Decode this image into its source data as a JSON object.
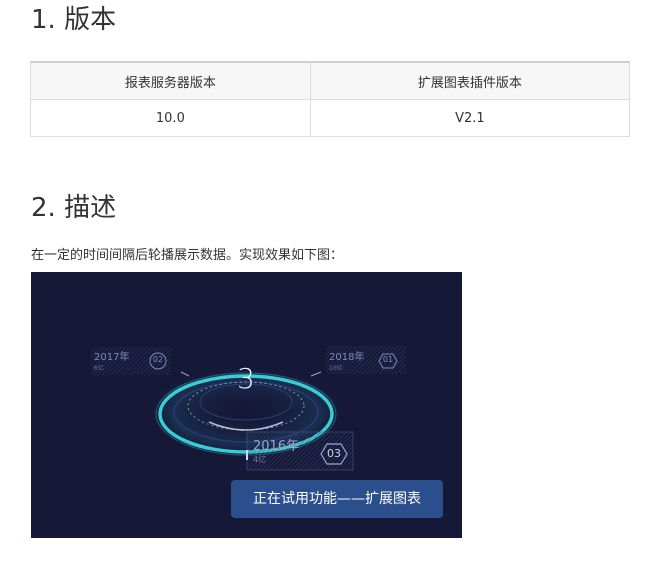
{
  "section1": {
    "title": "1. 版本"
  },
  "version_table": {
    "headers": [
      "报表服务器版本",
      "扩展图表插件版本"
    ],
    "rows": [
      [
        "10.0",
        "V2.1"
      ]
    ]
  },
  "section2": {
    "title": "2. 描述",
    "description": "在一定的时间间隔后轮播展示数据。实现效果如下图："
  },
  "demo": {
    "center_number": "3",
    "cards": [
      {
        "year": "2017年",
        "value": "6亿",
        "index": "02"
      },
      {
        "year": "2018年",
        "value": "10亿",
        "index": "01"
      },
      {
        "year": "2016年",
        "value": "4亿",
        "index": "03"
      }
    ],
    "trial_banner": "正在试用功能——扩展图表",
    "colors": {
      "background": "#161838",
      "ring": "#3de0e8",
      "banner": "#2a4f8c"
    }
  }
}
